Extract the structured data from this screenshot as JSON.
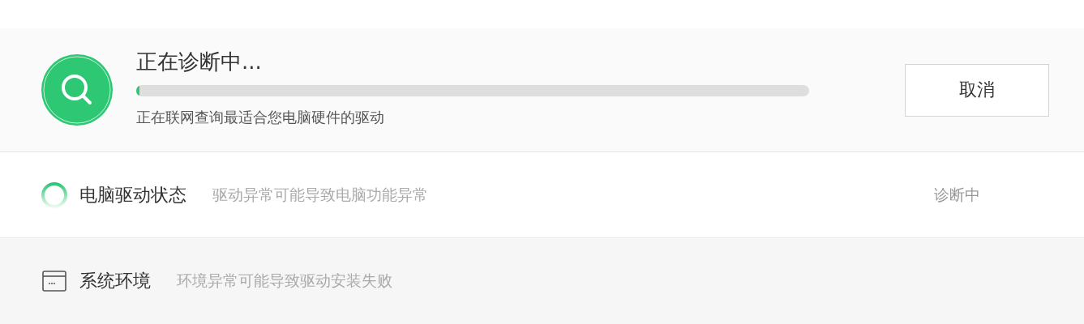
{
  "header": {
    "title": "正在诊断中...",
    "progress": {
      "level": 0.005
    },
    "subtitle": "正在联网查询最适合您电脑硬件的驱动",
    "cancel_button": "取消"
  },
  "items": [
    {
      "kind": "spinner",
      "name": "电脑驱动状态",
      "description": "驱动异常可能导致电脑功能异常",
      "status": "诊断中"
    },
    {
      "kind": "window",
      "name": "系统环境",
      "description": "环境异常可能导致驱动安装失败"
    }
  ]
}
